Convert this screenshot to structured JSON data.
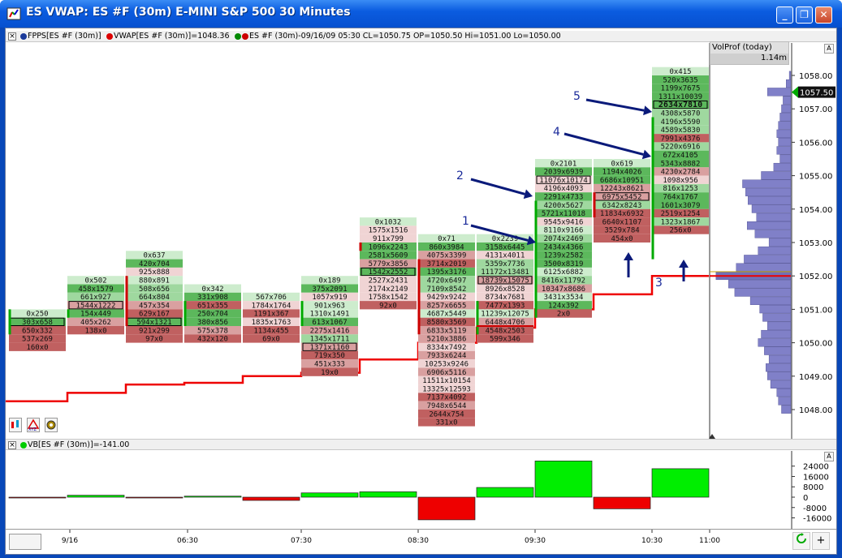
{
  "window": {
    "title": "ES VWAP: ES #F (30m) E-MINI S&P 500 30 Minutes",
    "minimize": "_",
    "restore": "❐",
    "close": "✕"
  },
  "legend": {
    "fpps": "FPPS[ES #F (30m)]",
    "vwap": "VWAP[ES #F (30m)]=1048.36",
    "bar": "ES #F (30m)-09/16/09 05:30 CL=1050.75 OP=1050.50 Hi=1051.00 Lo=1050.00"
  },
  "lower_legend": {
    "vb": "VB[ES #F (30m)]=-141.00"
  },
  "volprof": {
    "title": "VolProf (today)",
    "value": "1.14m"
  },
  "colors": {
    "buy_strong": "#5cb85c",
    "buy": "#9fd89f",
    "buy_light": "#cdeccd",
    "sell_strong": "#c06060",
    "sell": "#d9a0a0",
    "sell_light": "#f0d4d4",
    "vwap": "#ee0000",
    "delta_pos": "#00ee00",
    "delta_neg": "#ee0000",
    "profile": "#8080c8"
  },
  "price_axis": {
    "labels": [
      "1058.00",
      "1057.00",
      "1056.00",
      "1055.00",
      "1054.00",
      "1053.00",
      "1052.00",
      "1051.00",
      "1050.00",
      "1049.00",
      "1048.00"
    ],
    "current": "1057.50"
  },
  "delta_axis": {
    "labels": [
      "24000",
      "16000",
      "8000",
      "0",
      "-8000",
      "-16000"
    ]
  },
  "time_axis": {
    "labels": [
      "9/16",
      "06:30",
      "07:30",
      "08:30",
      "09:30",
      "10:30",
      "11:00"
    ]
  },
  "annotations": [
    "1",
    "2",
    "3",
    "4",
    "5"
  ],
  "columns": [
    {
      "top": 1051.0,
      "poc": 1,
      "rows": [
        "0x250",
        "303x658",
        "650x332",
        "537x269",
        "160x0"
      ]
    },
    {
      "top": 1052.0,
      "poc": 3,
      "rows": [
        "0x502",
        "458x1579",
        "661x927",
        "1544x1222",
        "154x449",
        "405x262",
        "138x0"
      ]
    },
    {
      "top": 1052.75,
      "poc": 8,
      "rows": [
        "0x637",
        "420x704",
        "925x888",
        "880x891",
        "508x656",
        "664x804",
        "457x354",
        "629x167",
        "594x1321",
        "921x299",
        "97x0"
      ]
    },
    {
      "top": 1051.75,
      "poc": -1,
      "rows": [
        "0x342",
        "331x908",
        "651x355",
        "250x704",
        "380x856",
        "575x378",
        "432x120"
      ]
    },
    {
      "top": 1051.5,
      "poc": -1,
      "rows": [
        "567x706",
        "1784x1764",
        "1191x367",
        "1835x1763",
        "1134x455",
        "69x0"
      ]
    },
    {
      "top": 1052.0,
      "poc": 8,
      "rows": [
        "0x189",
        "375x2091",
        "1057x919",
        "901x963",
        "1310x1491",
        "613x1067",
        "2275x1416",
        "1345x1711",
        "1371x1160",
        "719x350",
        "451x333",
        "19x0"
      ]
    },
    {
      "top": 1053.75,
      "poc": 6,
      "rows": [
        "0x1032",
        "1575x1516",
        "911x799",
        "1096x2243",
        "2581x5609",
        "5779x3856",
        "1542x2552",
        "2527x2431",
        "2174x2149",
        "1758x1542",
        "92x0"
      ]
    },
    {
      "top": 1053.25,
      "poc": 24,
      "rows": [
        "0x71",
        "860x3984",
        "4075x3399",
        "3714x2019",
        "1395x3176",
        "4720x6497",
        "7109x8542",
        "9429x9242",
        "8257x6655",
        "4687x5449",
        "8580x3569",
        "6833x5119",
        "5210x3886",
        "8334x7492",
        "7933x6244",
        "10253x9246",
        "6906x5116",
        "11511x10154",
        "13325x12593",
        "7137x4092",
        "7948x6544",
        "2644x754",
        "331x0"
      ]
    },
    {
      "top": 1053.25,
      "poc": 5,
      "rows": [
        "0x2239",
        "3158x6445",
        "4131x4011",
        "5359x7736",
        "11172x13481",
        "18739x15075",
        "8926x8528",
        "8734x7681",
        "7477x1393",
        "11239x12075",
        "6448x4706",
        "4548x2503",
        "599x346"
      ]
    },
    {
      "top": 1055.5,
      "poc": 2,
      "rows": [
        "0x2101",
        "2039x6939",
        "11076x10174",
        "4196x4093",
        "2291x4733",
        "4200x5627",
        "5721x11018",
        "9545x9416",
        "8110x9166",
        "2074x2469",
        "2434x4366",
        "1239x2582",
        "3500x8319",
        "6125x6882",
        "8416x11792",
        "10347x8686",
        "3431x3534",
        "124x392",
        "2x0"
      ]
    },
    {
      "top": 1055.5,
      "poc": 4,
      "rows": [
        "0x619",
        "1194x4026",
        "6686x10951",
        "12243x8621",
        "6975x5452",
        "6342x8243",
        "11834x6932",
        "6640x1107",
        "3529x784",
        "454x0"
      ]
    },
    {
      "top": 1058.25,
      "poc": 4,
      "rows": [
        "0x415",
        "520x3635",
        "1199x7675",
        "1311x10039",
        "2634x7810",
        "4308x5870",
        "4196x5590",
        "4589x5830",
        "7991x4376",
        "5220x6916",
        "672x4105",
        "5343x8882",
        "4230x2784",
        "1098x956",
        "816x1253",
        "764x1767",
        "1601x3079",
        "2519x1254",
        "1323x1867",
        "256x0"
      ]
    }
  ],
  "vwap_levels": [
    1048.25,
    1048.5,
    1048.75,
    1048.8,
    1049.0,
    1049.1,
    1049.5,
    1050.0,
    1050.45,
    1051.0,
    1051.45,
    1052.0
  ],
  "deltas": [
    -141,
    1500,
    -300,
    800,
    -2500,
    3300,
    4200,
    -17500,
    7500,
    28000,
    -9000,
    22000
  ],
  "volume_profile": [
    [
      1058.0,
      2
    ],
    [
      1057.75,
      6
    ],
    [
      1057.5,
      30
    ],
    [
      1057.25,
      10
    ],
    [
      1057.0,
      12
    ],
    [
      1056.75,
      14
    ],
    [
      1056.5,
      16
    ],
    [
      1056.25,
      18
    ],
    [
      1056.0,
      16
    ],
    [
      1055.75,
      18
    ],
    [
      1055.5,
      14
    ],
    [
      1055.25,
      22
    ],
    [
      1055.0,
      38
    ],
    [
      1054.75,
      62
    ],
    [
      1054.5,
      58
    ],
    [
      1054.25,
      55
    ],
    [
      1054.0,
      50
    ],
    [
      1053.75,
      44
    ],
    [
      1053.5,
      56
    ],
    [
      1053.25,
      46
    ],
    [
      1053.0,
      28
    ],
    [
      1052.75,
      42
    ],
    [
      1052.5,
      60
    ],
    [
      1052.25,
      70
    ],
    [
      1052.0,
      96
    ],
    [
      1051.75,
      80
    ],
    [
      1051.5,
      72
    ],
    [
      1051.25,
      52
    ],
    [
      1051.0,
      40
    ],
    [
      1050.75,
      36
    ],
    [
      1050.5,
      30
    ],
    [
      1050.25,
      38
    ],
    [
      1050.0,
      42
    ],
    [
      1049.75,
      34
    ],
    [
      1049.5,
      28
    ],
    [
      1049.25,
      32
    ],
    [
      1049.0,
      30
    ],
    [
      1048.75,
      26
    ],
    [
      1048.5,
      18
    ],
    [
      1048.25,
      16
    ],
    [
      1048.0,
      12
    ]
  ]
}
